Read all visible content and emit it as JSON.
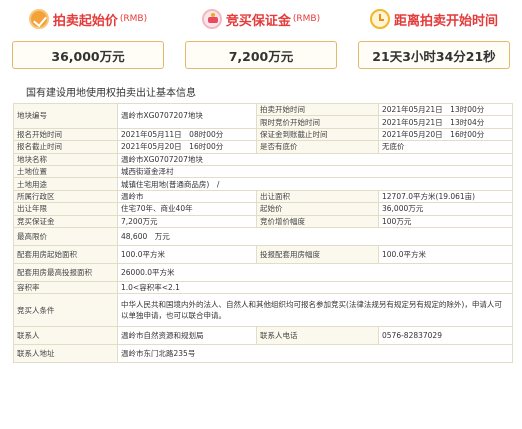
{
  "cards": [
    {
      "title": "拍卖起始价",
      "suffix": "(RMB)",
      "icon": "price-tag-icon",
      "value": "36,000万元"
    },
    {
      "title": "竞买保证金",
      "suffix": "(RMB)",
      "icon": "money-bag-icon",
      "value": "7,200万元"
    },
    {
      "title": "距离拍卖开始时间",
      "suffix": "",
      "icon": "alarm-clock-icon",
      "value": "21天3小时34分21秒"
    }
  ],
  "info_title": "国有建设用地使用权拍卖出让基本信息",
  "table": {
    "r1": {
      "l1": "地块编号",
      "v1": "温岭市XG0707207地块",
      "l2": "拍卖开始时间",
      "v2": "2021年05月21日　13时00分"
    },
    "r2": {
      "l2": "限时竞价开始时间",
      "v2": "2021年05月21日　13时04分"
    },
    "r3": {
      "l1": "报名开始时间",
      "v1": "2021年05月11日　08时00分",
      "l2": "保证金到账截止时间",
      "v2": "2021年05月20日　16时00分"
    },
    "r4": {
      "l1": "报名截止时间",
      "v1": "2021年05月20日　16时00分",
      "l2": "是否有底价",
      "v2": "无底价"
    },
    "r5": {
      "l1": "地块名称",
      "v1": "温岭市XG0707207地块"
    },
    "r6": {
      "l1": "土地位置",
      "v1": "城西街道金泽村"
    },
    "r7": {
      "l1": "土地用途",
      "v1": "城镇住宅用地(普通商品房)　/"
    },
    "r8": {
      "l1": "所属行政区",
      "v1": "温岭市",
      "l2": "出让面积",
      "v2": "12707.0平方米(19.061亩)"
    },
    "r9": {
      "l1": "出让年限",
      "v1": "住宅70年、商业40年",
      "l2": "起始价",
      "v2": "36,000万元"
    },
    "r10": {
      "l1": "竞买保证金",
      "v1": "7,200万元",
      "l2": "竞价增价幅度",
      "v2": "100万元"
    },
    "r11": {
      "l1": "最高限价",
      "v1": "48,600　万元"
    },
    "r12": {
      "l1": "配套用房起始面积",
      "v1": "100.0平方米",
      "l2": "投报配套用房幅度",
      "v2": "100.0平方米"
    },
    "r13": {
      "l1": "配套用房最高投报面积",
      "v1": "26000.0平方米"
    },
    "r14": {
      "l1": "容积率",
      "v1": "1.0<容积率<2.1"
    },
    "r15": {
      "l1": "竞买人条件",
      "v1": "中华人民共和国境内外的法人、自然人和其他组织均可报名参加竞买(法律法规另有规定另有规定的除外)，申请人可以单独申请，也可以联合申请。"
    },
    "r16": {
      "l1": "联系人",
      "v1": "温岭市自然资源和规划局",
      "l2": "联系人电话",
      "v2": "0576-82837029"
    },
    "r17": {
      "l1": "联系人地址",
      "v1": "温岭市东门北路235号"
    }
  }
}
